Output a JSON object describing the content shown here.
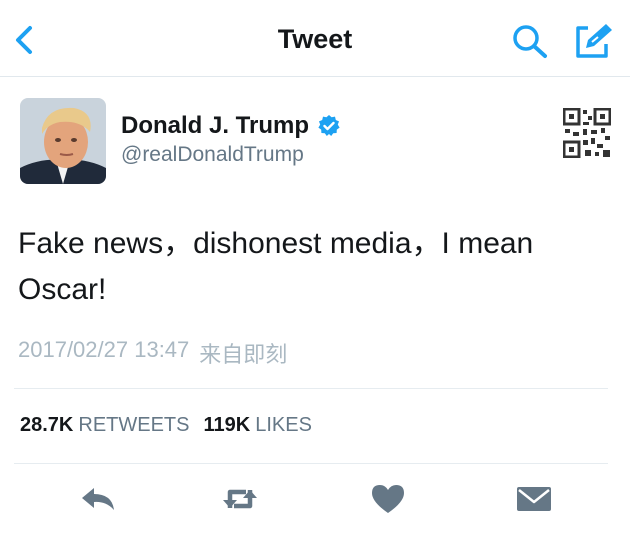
{
  "nav": {
    "title": "Tweet",
    "back_icon": "chevron-left-icon",
    "search_icon": "search-icon",
    "compose_icon": "compose-icon"
  },
  "tweet": {
    "author": {
      "name": "Donald J. Trump",
      "handle": "@realDonaldTrump",
      "verified": true
    },
    "text": "Fake news，dishonest media，I mean\nOscar!",
    "date": "2017/02/27 13:47",
    "source": "来自即刻"
  },
  "stats": {
    "retweets_count": "28.7K",
    "retweets_label": "RETWEETS",
    "likes_count": "119K",
    "likes_label": "LIKES"
  },
  "actions": {
    "reply_icon": "reply-icon",
    "retweet_icon": "retweet-icon",
    "like_icon": "heart-icon",
    "dm_icon": "envelope-icon"
  },
  "colors": {
    "accent": "#1da1f2",
    "text": "#14171a",
    "secondary": "#657786",
    "muted": "#aab8c2",
    "icon": "#657786"
  }
}
